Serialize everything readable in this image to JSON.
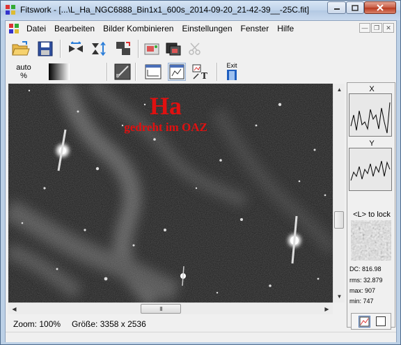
{
  "window": {
    "title": "Fitswork - [...\\L_Ha_NGC6888_Bin1x1_600s_2014-09-20_21-42-39__-25C.fit]"
  },
  "menu": [
    {
      "label": "Datei"
    },
    {
      "label": "Bearbeiten"
    },
    {
      "label": "Bilder Kombinieren"
    },
    {
      "label": "Einstellungen"
    },
    {
      "label": "Fenster"
    },
    {
      "label": "Hilfe"
    }
  ],
  "toolbar": {
    "auto_label": "auto",
    "auto_unit": "%",
    "exit_label": "Exit"
  },
  "image": {
    "overlay_title": "Ha",
    "overlay_subtitle": "gedreht im OAZ",
    "overlay_color": "#e01010"
  },
  "status": {
    "zoom": "Zoom: 100%",
    "size": "Größe: 3358 x 2536"
  },
  "panel": {
    "x_label": "X",
    "y_label": "Y",
    "lock_hint": "<L> to lock",
    "dc": "DC: 816.98",
    "rms": "rms: 32.879",
    "max": "max: 907",
    "min": "min: 747"
  },
  "scrollbar": {
    "grip": "III"
  }
}
